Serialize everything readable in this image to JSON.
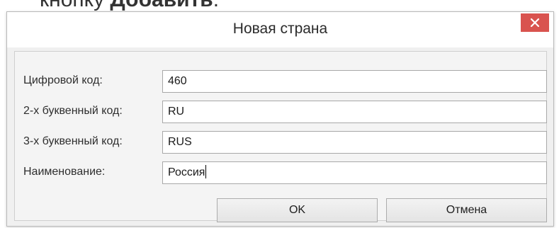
{
  "context": {
    "prefix_text": "кнопку ",
    "bold_text": "Добавить",
    "suffix_text": "."
  },
  "dialog": {
    "title": "Новая страна",
    "close_glyph": "×",
    "fields": [
      {
        "label": "Цифровой код:",
        "value": "460"
      },
      {
        "label": "2-х буквенный код:",
        "value": "RU"
      },
      {
        "label": "3-х буквенный код:",
        "value": "RUS"
      },
      {
        "label": "Наименование:",
        "value": "Россия"
      }
    ],
    "ok_label": "OK",
    "cancel_label": "Отмена"
  },
  "colors": {
    "close_button": "#d9534f",
    "dialog_background": "#f0f0f0"
  },
  "icons": {
    "close": "close-icon"
  }
}
